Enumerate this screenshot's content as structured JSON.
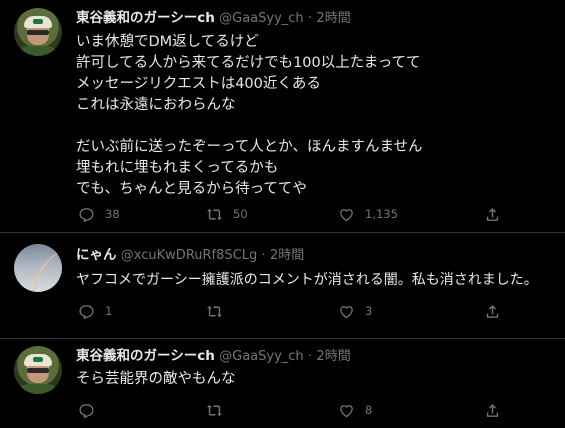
{
  "tweets": [
    {
      "name": "東谷義和のガーシーch",
      "handle": "@GaaSyy_ch",
      "dot": "·",
      "time": "2時間",
      "lines": [
        "いま休憩でDM返してるけど",
        "許可してる人から来てるだけでも100以上たまってて",
        "メッセージリクエストは400近くある",
        "これは永遠におわらんな",
        "",
        "だいぶ前に送ったぞーって人とか、ほんますんません",
        "埋もれに埋もれまくってるかも",
        "でも、ちゃんと見るから待っててや"
      ],
      "replies": "38",
      "retweets": "50",
      "likes": "1,135",
      "avatar": "man-with-cap-avatar"
    },
    {
      "name": "にゃん",
      "handle": "@xcuKwDRuRf8SCLg",
      "dot": "·",
      "time": "2時間",
      "lines": [
        "ヤフコメでガーシー擁護派のコメントが消される闇。私も消されました。"
      ],
      "replies": "1",
      "retweets": "",
      "likes": "3",
      "avatar": "rainbow-sky-avatar"
    },
    {
      "name": "東谷義和のガーシーch",
      "handle": "@GaaSyy_ch",
      "dot": "·",
      "time": "2時間",
      "lines": [
        "そら芸能界の敵やもんな"
      ],
      "replies": "",
      "retweets": "",
      "likes": "8",
      "avatar": "man-with-cap-avatar"
    }
  ],
  "icons": {
    "reply": "reply-icon",
    "retweet": "retweet-icon",
    "like": "heart-icon",
    "share": "share-icon"
  },
  "colors": {
    "background": "#000000",
    "text": "#e7e9ea",
    "muted": "#71767b",
    "divider": "#2f3336"
  }
}
